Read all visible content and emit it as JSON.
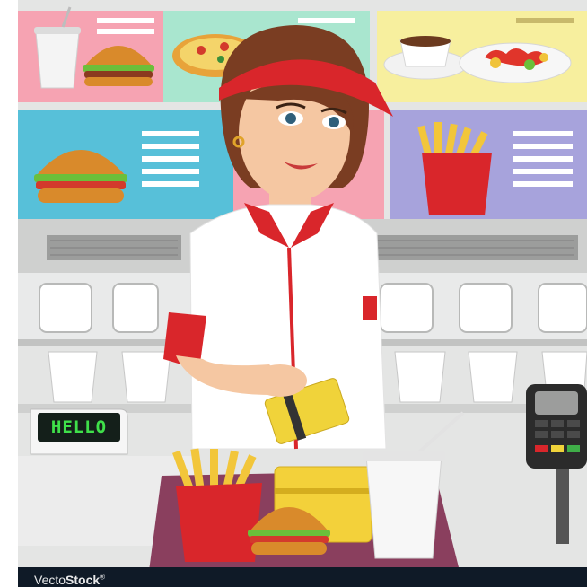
{
  "register_display": {
    "text": "HELLO",
    "color": "#3fe04a"
  },
  "watermark": {
    "prefix": "Vecto",
    "brand": "Stock",
    "mark": "®"
  },
  "colors": {
    "uniform_red": "#d9262b",
    "uniform_white": "#ffffff",
    "wall_grey": "#e6e6e6",
    "card_yellow": "#f0d33a"
  },
  "icons": [
    "menu-board",
    "burger",
    "pizza",
    "soda-cup",
    "french-fries",
    "coffee-cup",
    "salad",
    "credit-card",
    "payment-terminal",
    "tray"
  ]
}
